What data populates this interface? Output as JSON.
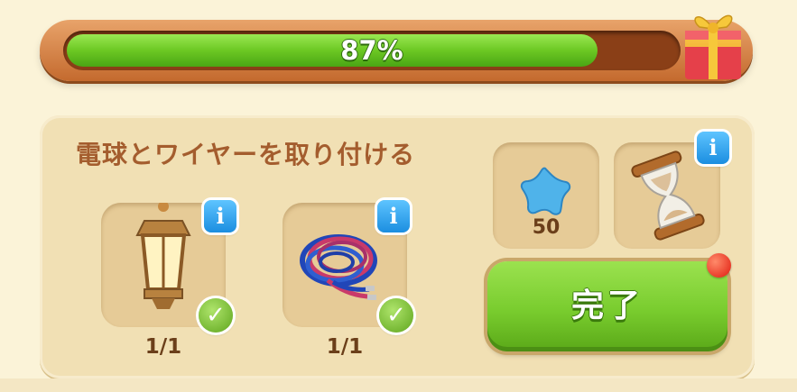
{
  "progress": {
    "percent_text": "87%",
    "value": 0.87
  },
  "task": {
    "title": "電球とワイヤーを取り付ける"
  },
  "items": [
    {
      "name": "lantern",
      "icon": "lantern-icon",
      "count": "1/1",
      "completed": true
    },
    {
      "name": "wire-bundle",
      "icon": "wire-bundle-icon",
      "count": "1/1",
      "completed": true
    }
  ],
  "reward": {
    "icon": "blue-star-icon",
    "value": "50"
  },
  "time": {
    "icon": "hourglass-icon"
  },
  "info_label": "i",
  "check_label": "✓",
  "complete_button": {
    "label": "完了"
  },
  "colors": {
    "accent_green": "#79cc2e",
    "title_brown": "#a45d2e",
    "info_blue": "#1b8ee0",
    "notify_red": "#e01a0e"
  }
}
